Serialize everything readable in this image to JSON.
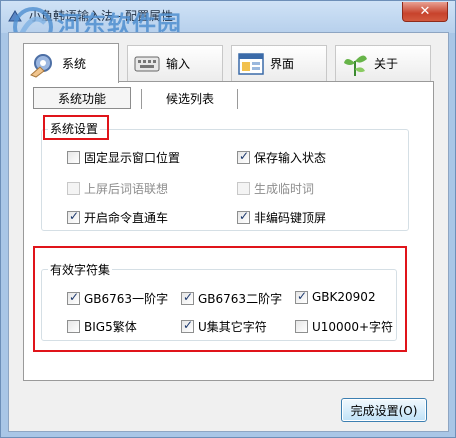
{
  "window": {
    "title": "小鱼韩语输入法 - 配置属性",
    "close_label": "✕"
  },
  "watermark": {
    "line1": "河东软件园",
    "line2": "www.pc0359.cn"
  },
  "tabs": [
    {
      "label": "系统",
      "icon": "gear-hand-icon",
      "active": true
    },
    {
      "label": "输入",
      "icon": "keyboard-icon",
      "active": false
    },
    {
      "label": "界面",
      "icon": "window-icon",
      "active": false
    },
    {
      "label": "关于",
      "icon": "plant-icon",
      "active": false
    }
  ],
  "subtabs": [
    {
      "label": "系统功能",
      "active": true
    },
    {
      "label": "候选列表",
      "active": false
    }
  ],
  "system_settings": {
    "title": "系统设置",
    "options": [
      {
        "label": "固定显示窗口位置",
        "checked": false,
        "enabled": true
      },
      {
        "label": "保存输入状态",
        "checked": true,
        "enabled": true
      },
      {
        "label": "上屏后词语联想",
        "checked": false,
        "enabled": false
      },
      {
        "label": "生成临时词",
        "checked": false,
        "enabled": false
      },
      {
        "label": "开启命令直通车",
        "checked": true,
        "enabled": true
      },
      {
        "label": "非编码键顶屏",
        "checked": true,
        "enabled": true
      }
    ]
  },
  "charset": {
    "title": "有效字符集",
    "options": [
      {
        "label": "GB6763一阶字",
        "checked": true
      },
      {
        "label": "GB6763二阶字",
        "checked": true
      },
      {
        "label": "GBK20902",
        "checked": true
      },
      {
        "label": "BIG5繁体",
        "checked": false
      },
      {
        "label": "U集其它字符",
        "checked": true
      },
      {
        "label": "U10000+字符",
        "checked": false
      }
    ]
  },
  "footer": {
    "done_label": "完成设置(O)"
  }
}
